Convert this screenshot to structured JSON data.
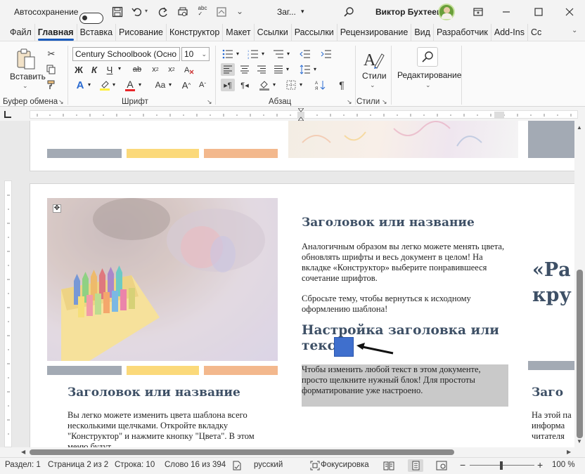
{
  "titlebar": {
    "autosave_label": "Автосохранение",
    "doc_title": "Заг...",
    "user_name": "Виктор Бухтеев"
  },
  "tabs": [
    "Файл",
    "Главная",
    "Вставка",
    "Рисование",
    "Конструктор",
    "Макет",
    "Ссылки",
    "Рассылки",
    "Рецензирование",
    "Вид",
    "Разработчик",
    "Add-Ins",
    "Сс"
  ],
  "ribbon": {
    "paste_label": "Вставить",
    "clipboard_group": "Буфер обмена",
    "font_name": "Century Schoolbook (Осно",
    "font_size": "10",
    "font_group": "Шрифт",
    "bold": "Ж",
    "italic": "К",
    "underline": "Ч",
    "paragraph_group": "Абзац",
    "styles_label": "Стили",
    "styles_group": "Стили",
    "editing_label": "Редактирование"
  },
  "document": {
    "left_heading": "Заголовок или название",
    "left_body": "Вы легко можете изменить цвета шаблона всего несколькими щелчками. Откройте вкладку \"Конструктор\" и нажмите кнопку \"Цвета\". В этом меню будут",
    "mid_heading1": "Заголовок или название",
    "mid_body1": "Аналогичным образом вы легко можете менять цвета, обновлять шрифты и весь документ в целом! На вкладке «Конструктор» выберите понравившееся сочетание шрифтов.",
    "mid_body2": "Сбросьте тему, чтобы вернуться к исходному оформлению шаблона!",
    "mid_heading2": "Настройка заголовка или текста",
    "mid_body3": "Чтобы изменить любой текст в этом документе, просто щелкните нужный блок! Для простоты форматирование уже настроено.",
    "right_quote": "«Ра кру",
    "right_heading": "Заго",
    "right_body": "На этой па информа читателя"
  },
  "status": {
    "section": "Раздел: 1",
    "page": "Страница 2 из 2",
    "line": "Строка: 10",
    "words": "Слово 16 из 394",
    "language": "русский",
    "focus": "Фокусировка",
    "zoom": "100 %"
  }
}
